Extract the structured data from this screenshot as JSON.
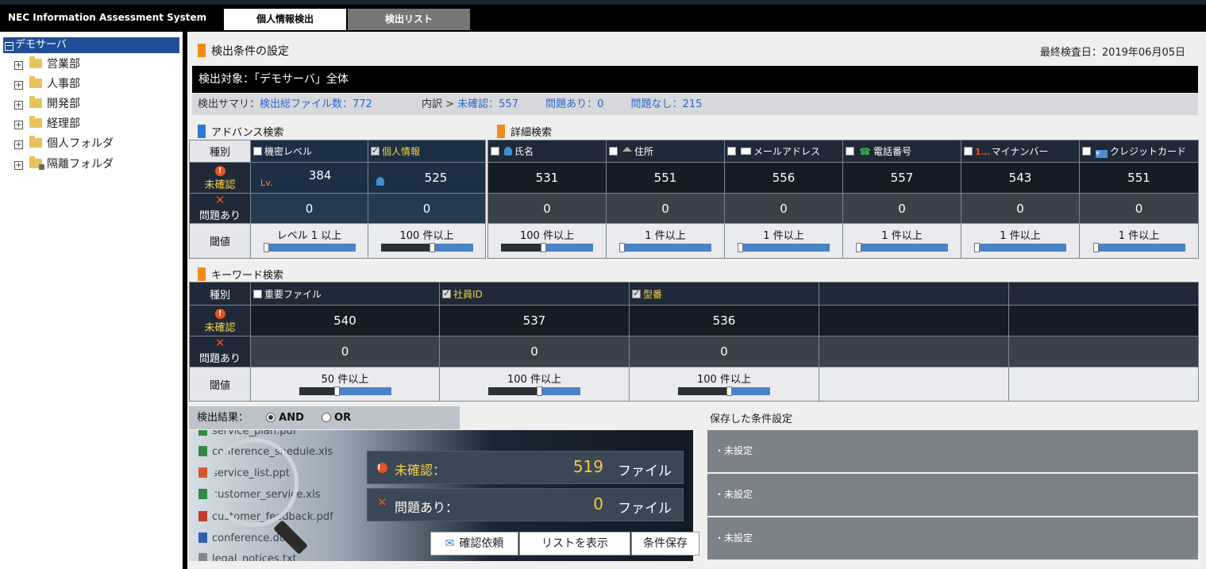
{
  "app": {
    "title": "NEC Information Assessment System"
  },
  "tabs": [
    {
      "label": "個人情報検出"
    },
    {
      "label": "検出リスト"
    }
  ],
  "sidebar": {
    "root": {
      "label": "デモサーバ",
      "toggle": "−"
    },
    "items": [
      {
        "label": "営業部",
        "toggle": "+"
      },
      {
        "label": "人事部",
        "toggle": "+"
      },
      {
        "label": "開発部",
        "toggle": "+"
      },
      {
        "label": "経理部",
        "toggle": "+"
      },
      {
        "label": "個人フォルダ",
        "toggle": "+"
      },
      {
        "label": "隔離フォルダ",
        "toggle": "+"
      }
    ]
  },
  "header": {
    "title": "検出条件の設定",
    "last_check": "最終検査日：2019年06月05日",
    "target": "検出対象：「デモサーバ」全体"
  },
  "summary": {
    "prefix": "検出サマリ：",
    "total": "検出総ファイル数：772",
    "breakdown": "内訳 >",
    "unconfirmed": "未確認：557",
    "problem": "問題あり：0",
    "no_problem": "問題なし：215"
  },
  "row_labels": {
    "type": "種別",
    "unconfirmed": "未確認",
    "problem": "問題あり",
    "threshold": "閾値",
    "warn_glyph": "!",
    "x_glyph": "✕"
  },
  "advanced": {
    "title": "アドバンス検索",
    "lv_tag": "Lv.",
    "columns": [
      {
        "label": "機密レベル",
        "checked": false,
        "unconfirmed": "384",
        "problem": "0",
        "threshold": "レベル 1 以上",
        "level": 0.0
      },
      {
        "label": "個人情報",
        "checked": true,
        "unconfirmed": "525",
        "problem": "0",
        "threshold": "100 件以上",
        "level": 0.55
      }
    ]
  },
  "detail": {
    "title": "詳細検索",
    "columns": [
      {
        "label": "氏名",
        "icon": "person-icon",
        "unconfirmed": "531",
        "problem": "0",
        "threshold": "100 件以上",
        "level": 0.45
      },
      {
        "label": "住所",
        "icon": "house-icon",
        "unconfirmed": "551",
        "problem": "0",
        "threshold": "1 件以上",
        "level": 0.0
      },
      {
        "label": "メールアドレス",
        "icon": "mail-icon",
        "unconfirmed": "556",
        "problem": "0",
        "threshold": "1 件以上",
        "level": 0.0
      },
      {
        "label": "電話番号",
        "icon": "phone-icon",
        "unconfirmed": "557",
        "problem": "0",
        "threshold": "1 件以上",
        "level": 0.0
      },
      {
        "label": "マイナンバー",
        "icon": "mynumber-icon",
        "unconfirmed": "543",
        "problem": "0",
        "threshold": "1 件以上",
        "level": 0.0
      },
      {
        "label": "クレジットカード",
        "icon": "card-icon",
        "unconfirmed": "551",
        "problem": "0",
        "threshold": "1 件以上",
        "level": 0.0
      }
    ]
  },
  "keyword": {
    "title": "キーワード検索",
    "columns": [
      {
        "label": "重要ファイル",
        "checked": false,
        "unconfirmed": "540",
        "problem": "0",
        "threshold": "50 件以上",
        "level": 0.4
      },
      {
        "label": "社員ID",
        "checked": true,
        "unconfirmed": "537",
        "problem": "0",
        "threshold": "100 件以上",
        "level": 0.55
      },
      {
        "label": "型番",
        "checked": true,
        "unconfirmed": "536",
        "problem": "0",
        "threshold": "100 件以上",
        "level": 0.55
      }
    ]
  },
  "result": {
    "label": "検出結果：",
    "and": "AND",
    "or": "OR",
    "files": [
      "service_plan.pdf",
      "conference_shedule.xls",
      "service_list.ppt",
      "customer_service.xls",
      "customer_feedback.pdf",
      "conference.doc",
      "legal_notices.txt"
    ],
    "unconfirmed_label": "未確認：",
    "unconfirmed_count": "519",
    "problem_label": "問題あり：",
    "problem_count": "0",
    "unit": "ファイル",
    "buttons": {
      "request": "確認依頼",
      "show_list": "リストを表示",
      "save": "条件保存"
    }
  },
  "saved": {
    "title": "保存した条件設定",
    "items": [
      "・未設定",
      "・未設定",
      "・未設定"
    ]
  },
  "colors": {
    "accent_orange": "#f08c1e",
    "accent_blue": "#2f7ad6",
    "link_blue": "#2b66c9",
    "warn": "#e8521e"
  }
}
